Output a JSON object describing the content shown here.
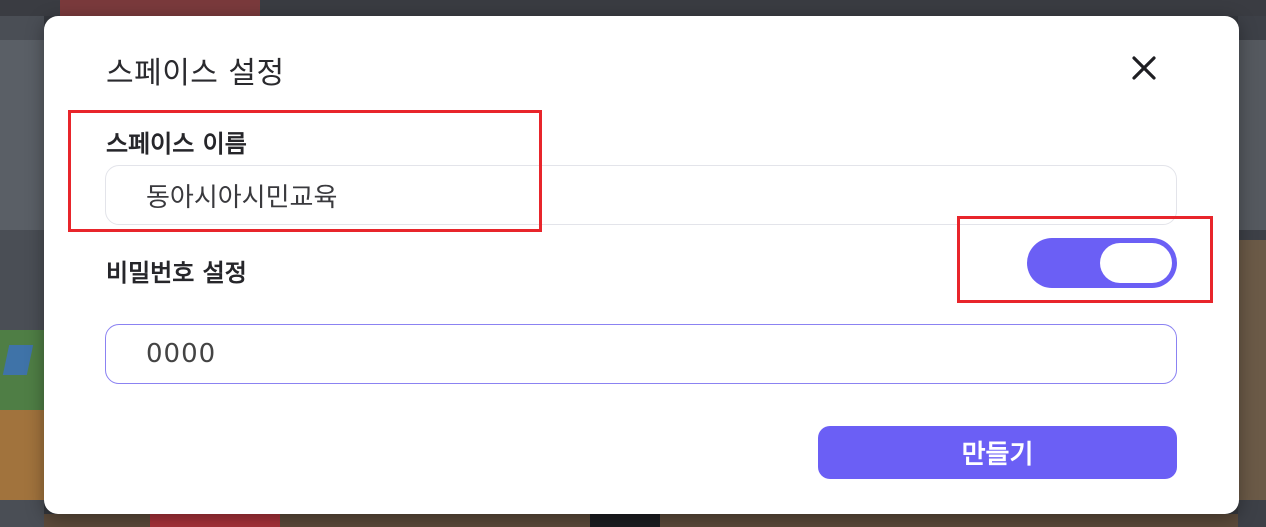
{
  "modal": {
    "title": "스페이스 설정",
    "close_icon": "close-icon"
  },
  "space_name": {
    "label": "스페이스 이름",
    "value": "동아시아시민교육"
  },
  "password": {
    "label": "비밀번호 설정",
    "toggle_on": true,
    "value": "0000"
  },
  "actions": {
    "create_label": "만들기"
  },
  "colors": {
    "accent": "#6b5ff5",
    "annotation": "#e8252b"
  }
}
